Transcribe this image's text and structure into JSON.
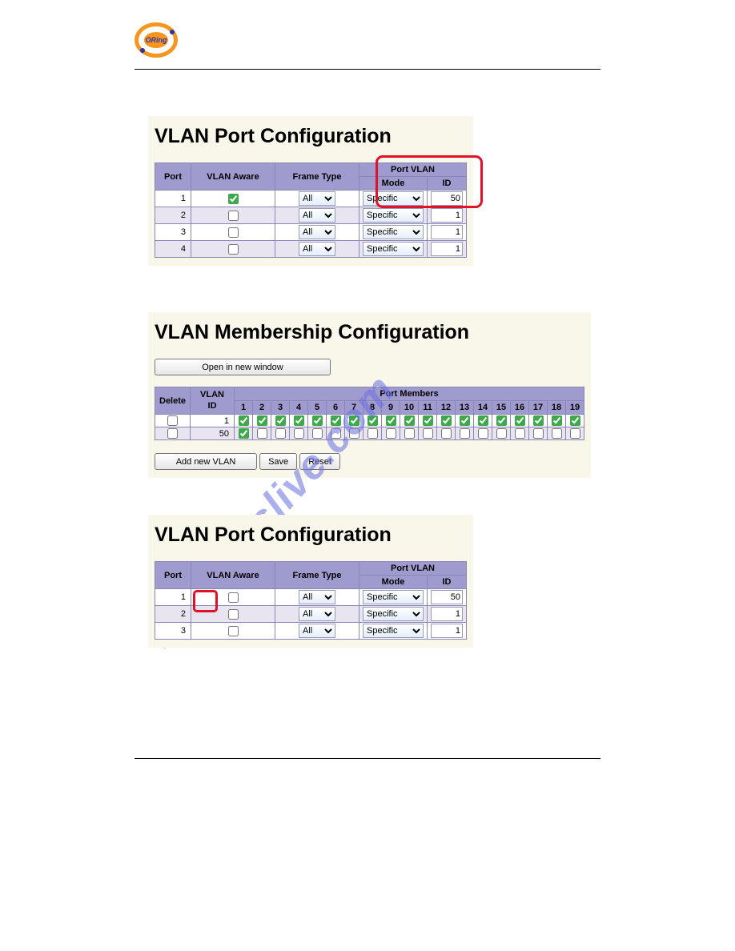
{
  "logo_text": "ORing",
  "watermark": "manualslive.com",
  "pvc1": {
    "title": "VLAN Port Configuration",
    "headers": {
      "port": "Port",
      "aware": "VLAN Aware",
      "frame": "Frame Type",
      "pv": "Port VLAN",
      "mode": "Mode",
      "id": "ID"
    },
    "rows": [
      {
        "port": "1",
        "aware": true,
        "frame": "All",
        "mode": "Specific",
        "id": "50"
      },
      {
        "port": "2",
        "aware": false,
        "frame": "All",
        "mode": "Specific",
        "id": "1"
      },
      {
        "port": "3",
        "aware": false,
        "frame": "All",
        "mode": "Specific",
        "id": "1"
      },
      {
        "port": "4",
        "aware": false,
        "frame": "All",
        "mode": "Specific",
        "id": "1"
      }
    ]
  },
  "membership": {
    "title": "VLAN Membership Configuration",
    "open_btn": "Open in new window",
    "add_btn": "Add new VLAN",
    "save_btn": "Save",
    "reset_btn": "Reset",
    "headers": {
      "delete": "Delete",
      "vlan": "VLAN\nID",
      "members_title": "Port Members",
      "ports": [
        "1",
        "2",
        "3",
        "4",
        "5",
        "6",
        "7",
        "8",
        "9",
        "10",
        "11",
        "12",
        "13",
        "14",
        "15",
        "16",
        "17",
        "18",
        "19"
      ]
    },
    "rows": [
      {
        "delete": false,
        "vlan": "1",
        "members": [
          true,
          true,
          true,
          true,
          true,
          true,
          true,
          true,
          true,
          true,
          true,
          true,
          true,
          true,
          true,
          true,
          true,
          true,
          true
        ]
      },
      {
        "delete": false,
        "vlan": "50",
        "members": [
          true,
          false,
          false,
          false,
          false,
          false,
          false,
          false,
          false,
          false,
          false,
          false,
          false,
          false,
          false,
          false,
          false,
          false,
          false
        ]
      }
    ]
  },
  "pvc2": {
    "title": "VLAN Port Configuration",
    "headers": {
      "port": "Port",
      "aware": "VLAN Aware",
      "frame": "Frame Type",
      "pv": "Port VLAN",
      "mode": "Mode",
      "id": "ID"
    },
    "rows": [
      {
        "port": "1",
        "aware": false,
        "frame": "All",
        "mode": "Specific",
        "id": "50"
      },
      {
        "port": "2",
        "aware": false,
        "frame": "All",
        "mode": "Specific",
        "id": "1"
      },
      {
        "port": "3",
        "aware": false,
        "frame": "All",
        "mode": "Specific",
        "id": "1"
      }
    ]
  }
}
